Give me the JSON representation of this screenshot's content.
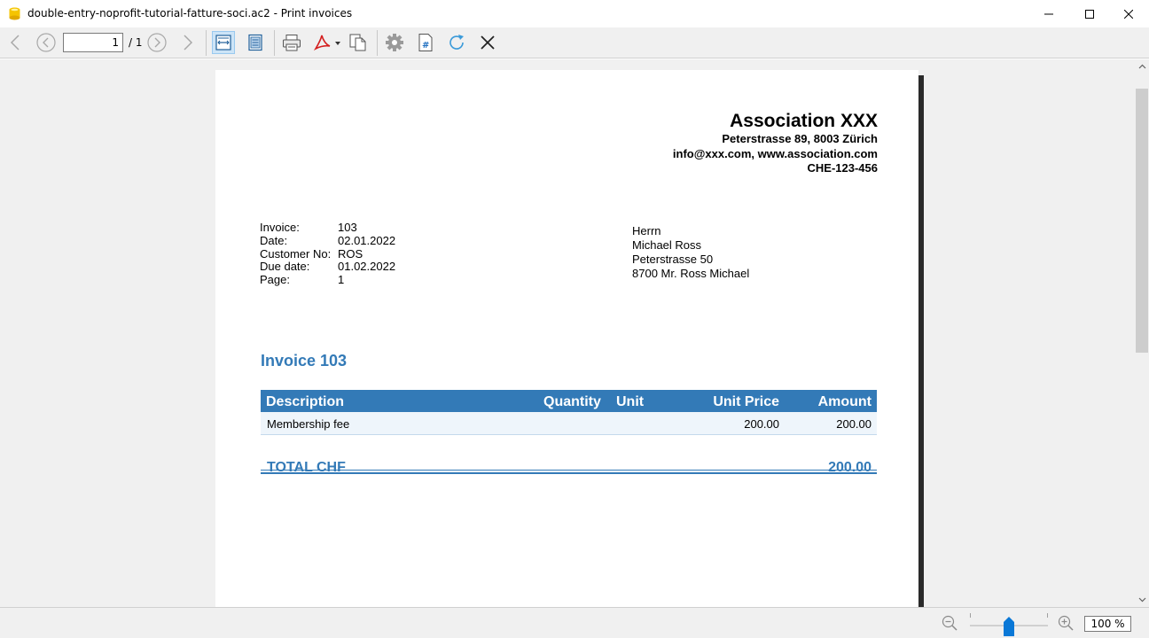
{
  "window": {
    "title": "double-entry-noprofit-tutorial-fatture-soci.ac2 - Print invoices"
  },
  "toolbar": {
    "page_current": "1",
    "page_total": "/ 1",
    "icons": [
      "back-icon",
      "previous-page-icon",
      "next-page-icon",
      "forward-icon",
      "fit-width-icon",
      "fit-page-icon",
      "print-icon",
      "pdf-export-icon",
      "copy-icon",
      "settings-icon",
      "page-numbering-icon",
      "refresh-icon",
      "close-icon"
    ]
  },
  "invoice": {
    "company_name": "Association XXX",
    "company_address": "Peterstrasse 89, 8003 Zürich",
    "company_contact": "info@xxx.com, www.association.com",
    "company_vat": "CHE-123-456",
    "meta": [
      {
        "label": "Invoice:",
        "value": "103"
      },
      {
        "label": "Date:",
        "value": "02.01.2022"
      },
      {
        "label": "Customer No:",
        "value": "ROS"
      },
      {
        "label": "Due date:",
        "value": "01.02.2022"
      },
      {
        "label": "Page:",
        "value": "1"
      }
    ],
    "address": [
      "Herrn",
      "Michael Ross",
      "Peterstrasse 50",
      "8700 Mr. Ross Michael"
    ],
    "title": "Invoice 103",
    "table_headers": {
      "description": "Description",
      "quantity": "Quantity",
      "unit": "Unit",
      "unit_price": "Unit Price",
      "amount": "Amount"
    },
    "rows": [
      {
        "description": "Membership fee",
        "quantity": "",
        "unit": "",
        "unit_price": "200.00",
        "amount": "200.00"
      }
    ],
    "total_label": "TOTAL CHF",
    "total_amount": "200.00",
    "accent_color": "#337ab7"
  },
  "statusbar": {
    "zoom": "100 %"
  }
}
